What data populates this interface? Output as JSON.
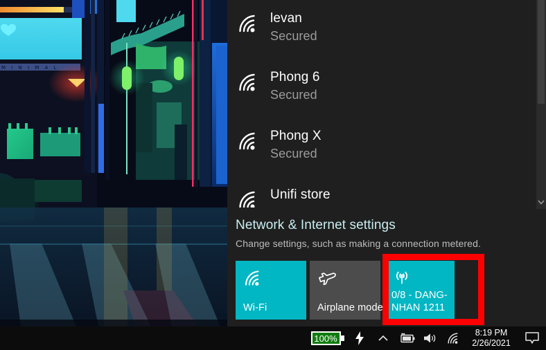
{
  "desktop": {
    "wallpaper_label": "MINIMAL",
    "wallpaper_theme": "cyberpunk-minimal-street",
    "colors": {
      "accent_cyan": "#00b7c3",
      "panel_bg": "#1f1f1f",
      "taskbar_bg": "#0c0c0c",
      "highlight_red": "#ff0000",
      "battery_green": "#107c10",
      "link_text": "#c9eef0"
    }
  },
  "flyout": {
    "networks": [
      {
        "name": "levan",
        "status": "Secured",
        "icon": "wifi-icon",
        "bars": 3
      },
      {
        "name": "Phong 6",
        "status": "Secured",
        "icon": "wifi-icon",
        "bars": 3
      },
      {
        "name": "Phong X",
        "status": "Secured",
        "icon": "wifi-icon",
        "bars": 3
      },
      {
        "name": "Unifi store",
        "status": "",
        "icon": "wifi-icon",
        "bars": 3
      }
    ],
    "scrollbar": {
      "down_icon": "chevron-down-icon"
    },
    "settings": {
      "title": "Network & Internet settings",
      "description": "Change settings, such as making a connection metered."
    },
    "tiles": [
      {
        "id": "wifi",
        "label": "Wi-Fi",
        "icon": "wifi-icon",
        "state": "on",
        "highlighted": false
      },
      {
        "id": "airplane-mode",
        "label": "Airplane mode",
        "icon": "airplane-icon",
        "state": "off",
        "highlighted": false
      },
      {
        "id": "mobile-hotspot",
        "label": "0/8 - DANG-NHAN 1211",
        "icon": "hotspot-icon",
        "state": "on",
        "highlighted": true
      }
    ]
  },
  "annotation": {
    "arrow": {
      "shape": "curved-down-arrow",
      "color": "#ff0000",
      "points_to": "mobile-hotspot tile"
    },
    "box": {
      "shape": "rectangle-outline",
      "color": "#ff0000",
      "around": "mobile-hotspot tile"
    }
  },
  "taskbar": {
    "battery_percent": "100%",
    "icons": [
      {
        "name": "battery-percent-badge",
        "label": "100%"
      },
      {
        "name": "power-bolt-icon",
        "label": ""
      },
      {
        "name": "chevron-up-icon",
        "label": ""
      },
      {
        "name": "battery-charging-icon",
        "label": ""
      },
      {
        "name": "speaker-icon",
        "label": ""
      },
      {
        "name": "wifi-tray-icon",
        "label": ""
      }
    ],
    "clock": {
      "time": "8:19 PM",
      "date": "2/26/2021"
    },
    "action_center_icon": "action-center-icon"
  }
}
